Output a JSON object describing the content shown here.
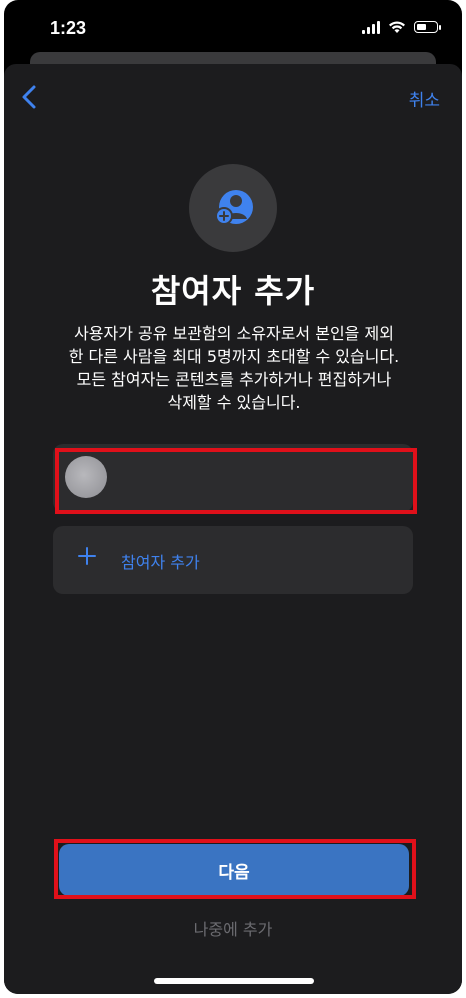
{
  "status_bar": {
    "time": "1:23"
  },
  "nav": {
    "cancel_label": "취소"
  },
  "header": {
    "title": "참여자 추가",
    "description": "사용자가 공유 보관함의 소유자로서 본인을 제외\n한 다른 사람을 최대 5명까지 초대할 수 있습니다.\n모든 참여자는 콘텐츠를 추가하거나 편집하거나\n삭제할 수 있습니다."
  },
  "participants": {
    "add_label": "참여자 추가"
  },
  "actions": {
    "next_label": "다음",
    "later_label": "나중에 추가"
  },
  "colors": {
    "accent": "#3f82ee",
    "primary_button": "#3a74c2",
    "highlight": "#e0101a",
    "sheet_bg": "#1c1c1e"
  },
  "icons": {
    "back": "chevron-left-icon",
    "hero": "add-person-icon",
    "add": "plus-icon"
  }
}
